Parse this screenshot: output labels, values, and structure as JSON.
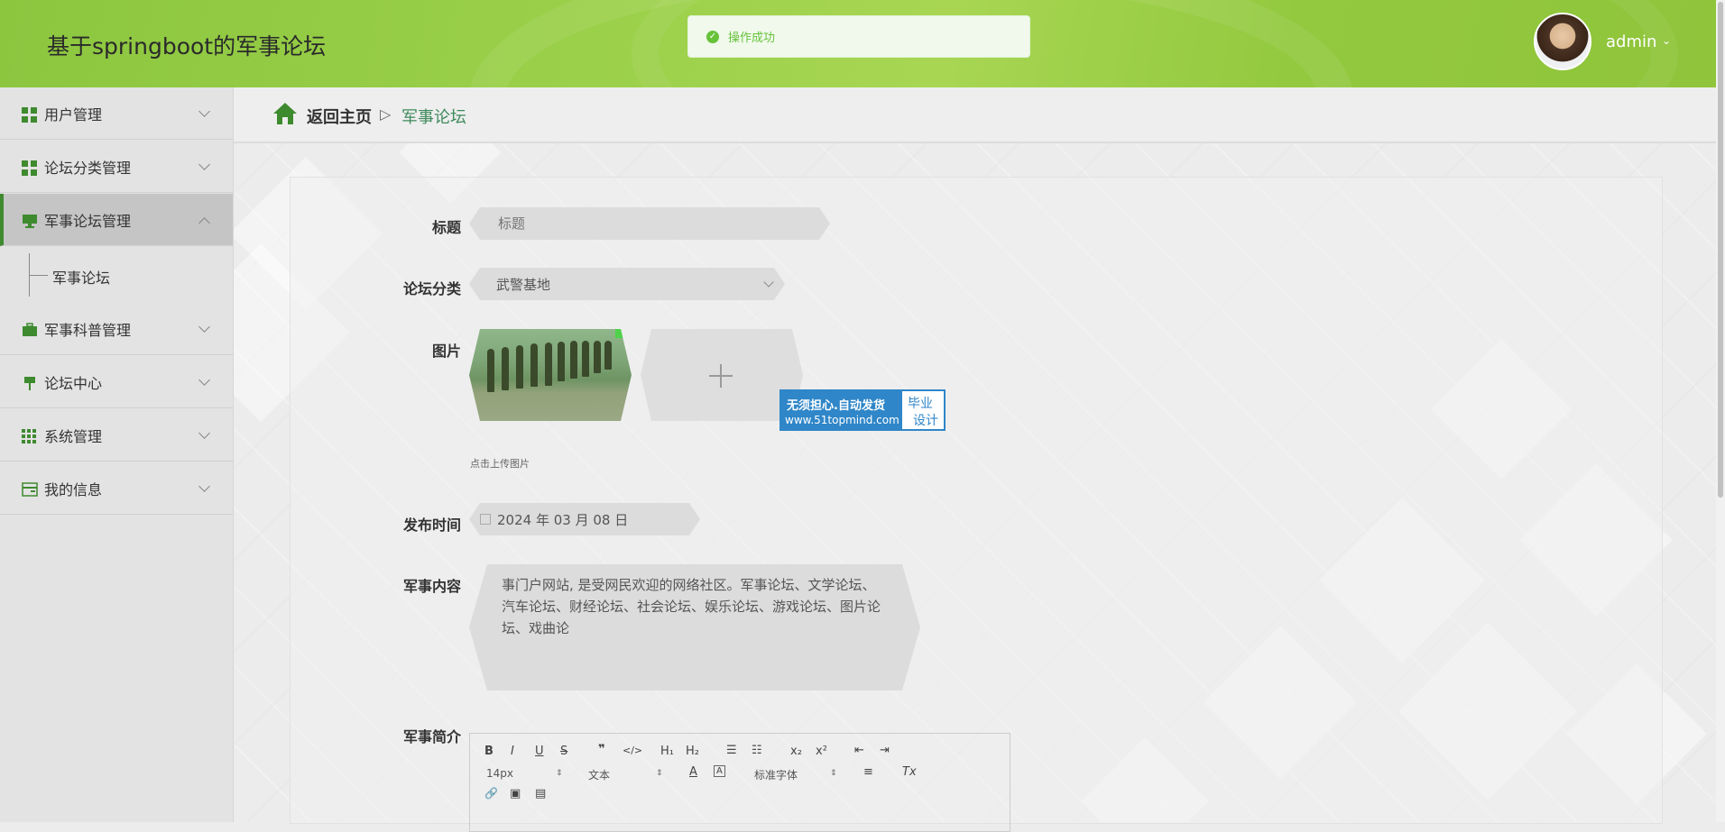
{
  "header": {
    "app_title": "基于springboot的军事论坛",
    "toast": "操作成功",
    "user": "admin"
  },
  "sidebar": {
    "items": [
      {
        "label": "用户管理",
        "icon": "dashboard-grid-icon"
      },
      {
        "label": "论坛分类管理",
        "icon": "dashboard-grid-icon"
      },
      {
        "label": "军事论坛管理",
        "icon": "monitor-icon",
        "expanded": true
      },
      {
        "label": "军事科普管理",
        "icon": "briefcase-icon"
      },
      {
        "label": "论坛中心",
        "icon": "pin-icon"
      },
      {
        "label": "系统管理",
        "icon": "apps-grid-icon"
      },
      {
        "label": "我的信息",
        "icon": "id-card-icon"
      }
    ],
    "sub_item": "军事论坛"
  },
  "breadcrumb": {
    "home": "返回主页",
    "separator": "▷",
    "current": "军事论坛"
  },
  "form": {
    "title_label": "标题",
    "title_placeholder": "标题",
    "category_label": "论坛分类",
    "category_value": "武警基地",
    "image_label": "图片",
    "upload_tip": "点击上传图片",
    "watermark_line1": "无须担心.自动发货",
    "watermark_line2": "www.51topmind.com",
    "watermark_right1": "毕业",
    "watermark_right2": "设计",
    "date_label": "发布时间",
    "date_value": "2024 年 03 月 08 日",
    "content_label": "军事内容",
    "content_value": "事门户网站, 是受网民欢迎的网络社区。军事论坛、文学论坛、汽车论坛、财经论坛、社会论坛、娱乐论坛、游戏论坛、图片论坛、戏曲论",
    "intro_label": "军事简介"
  },
  "editor": {
    "font_size": "14px",
    "text_format": "文本",
    "font_family": "标准字体",
    "buttons": {
      "bold": "B",
      "italic": "I",
      "underline": "U",
      "strike": "S",
      "quote": "❞",
      "code": "</>",
      "h1": "H₁",
      "h2": "H₂",
      "ordered": "☰",
      "bullet": "☷",
      "sub": "x₂",
      "sup": "x²",
      "outdent": "⇤",
      "indent": "⇥",
      "color": "A",
      "background": "A",
      "align": "≡",
      "clean": "Tx",
      "link": "🔗",
      "image": "▣",
      "video": "▤"
    }
  },
  "colors": {
    "header_green": "#8cc63f",
    "accent_green": "#3e8a2f",
    "toast_green": "#67c23a"
  }
}
